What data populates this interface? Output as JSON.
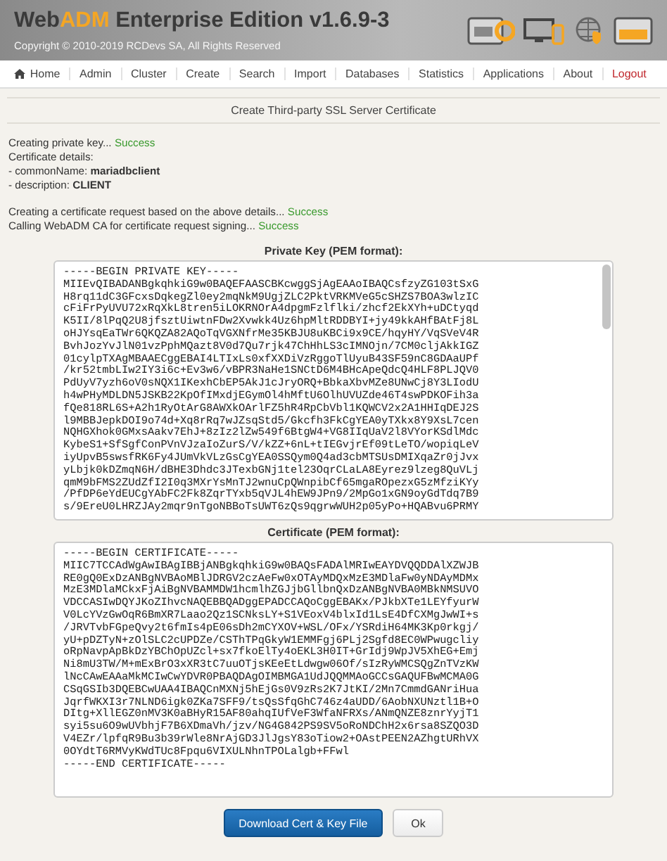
{
  "header": {
    "title_segments": [
      {
        "text": "Web",
        "kind": "plain"
      },
      {
        "text": "ADM",
        "kind": "accent"
      },
      {
        "text": " Enterprise Edition v1.6.9-3",
        "kind": "plain"
      }
    ],
    "copyright": "Copyright © 2010-2019 RCDevs SA, All Rights Reserved"
  },
  "nav": [
    {
      "label": "Home",
      "kind": "home"
    },
    {
      "label": "Admin",
      "kind": "link"
    },
    {
      "label": "Cluster",
      "kind": "link"
    },
    {
      "label": "Create",
      "kind": "link"
    },
    {
      "label": "Search",
      "kind": "link"
    },
    {
      "label": "Import",
      "kind": "link"
    },
    {
      "label": "Databases",
      "kind": "link"
    },
    {
      "label": "Statistics",
      "kind": "link"
    },
    {
      "label": "Applications",
      "kind": "link"
    },
    {
      "label": "About",
      "kind": "link"
    },
    {
      "label": "Logout",
      "kind": "logout"
    }
  ],
  "page_title": "Create Third-party SSL Server Certificate",
  "log_groups": [
    [
      {
        "kind": "step",
        "text": "Creating private key...",
        "result": "Success"
      },
      {
        "kind": "plain",
        "text": "Certificate details:"
      },
      {
        "kind": "detail",
        "text": "- commonName:",
        "value": "mariadbclient"
      },
      {
        "kind": "detail",
        "text": "- description:",
        "value": "CLIENT"
      }
    ],
    [
      {
        "kind": "step",
        "text": "Creating a certificate request based on the above details...",
        "result": "Success"
      },
      {
        "kind": "step",
        "text": "Calling WebADM CA for certificate request signing...",
        "result": "Success"
      }
    ]
  ],
  "private_key": {
    "label": "Private Key (PEM format):",
    "lines": [
      "-----BEGIN PRIVATE KEY-----",
      "MIIEvQIBADANBgkqhkiG9w0BAQEFAASCBKcwggSjAgEAAoIBAQCsfzyZG103tSxG",
      "H8rq11dC3GFcxsDqkegZl0ey2mqNkM9UgjZLC2PktVRKMVeG5cSHZS7BOA3wlzIC",
      "cFiFrPyUVU72xRqXkL8tren5iLOKRNOrA4dpgmFzlflki/zhcf2EkXYh+uDCtyqd",
      "K5II/8lPqQ2U8jfsztUiwtnFDw2Xvwkk4Uz6hpMltRDDBYI+jy49kkAHfBAtFj8L",
      "oHJYsqEaTWr6QKQZA82AQoTqVGXNfrMe35KBJU8uKBCi9x9CE/hqyHY/VqSVeV4R",
      "BvhJozYvJlN01vzPphMQazt8V0d7Qu7rjk47ChHhLS3cIMNOjn/7CM0cljAkkIGZ",
      "01cylpTXAgMBAAECggEBAI4LTIxLs0xfXXDiVzRggoTlUyuB43SF59nC8GDAaUPf",
      "/kr52tmbLIw2IY3i6c+Ev3w6/vBPR3NaHe1SNCtD6M4BHcApeQdcQ4HLF8PLJQV0",
      "PdUyV7yzh6oV0sNQX1IKexhCbEP5AkJ1cJryORQ+BbkaXbvMZe8UNwCj8Y3LIodU",
      "h4wPHyMDLDN5JSKB22KpOfIMxdjEGymOl4hMftU6OlhUVUZde46T4swPDKOFih3a",
      "fQe818RL6S+A2h1RyOtArG8AWXkOArlFZ5hR4RpCbVbl1KQWCV2x2A1HHIqDEJ2S",
      "l9MBBJepkDOI9o74d+Xq8rRq7wJZsqStd5/Gkcfh3FkCgYEA0yTXkx8Y9XsL7cen",
      "NQHGXhok0GMxsAakv7EhJ+8zIz2lZw549f6BtgW4+VG8IIqUaV2l8VYorKSdlMdc",
      "KybeS1+SfSgfConPVnVJzaIoZurS/V/kZZ+6nL+tIEGvjrEf09tLeTO/wopiqLeV",
      "iyUpvB5swsfRK6Fy4JUmVkVLzGsCgYEA0SSQym0Q4ad3cbMTSUsDMIXqaZr0jJvx",
      "yLbjk0kDZmqN6H/dBHE3Dhdc3JTexbGNj1tel23OqrCLaLA8Eyrez9lzeg8QuVLj",
      "qmM9bFMS2ZUdZfI2I0q3MXrYsMnTJ2wnuCpQWnpibCf65mgaROpezxG5zMfziKYy",
      "/PfDP6eYdEUCgYAbFC2Fk8ZqrTYxb5qVJL4hEW9JPn9/2MpGo1xGN9oyGdTdq7B9",
      "s/9EreU0LHRZJAy2mqr9nTgoNBBoTsUWT6zQs9qgrwWUH2p05yPo+HQABvu6PRMY"
    ]
  },
  "certificate": {
    "label": "Certificate (PEM format):",
    "lines": [
      "-----BEGIN CERTIFICATE-----",
      "MIIC7TCCAdWgAwIBAgIBBjANBgkqhkiG9w0BAQsFADAlMRIwEAYDVQQDDAlXZWJB",
      "RE0gQ0ExDzANBgNVBAoMBlJDRGV2czAeFw0xOTAyMDQxMzE3MDlaFw0yNDAyMDMx",
      "MzE3MDlaMCkxFjAiBgNVBAMMDW1hcmlhZGJjbGllbnQxDzANBgNVBA0MBkNMSUVO",
      "VDCCASIwDQYJKoZIhvcNAQEBBQADggEPADCCAQoCggEBAKx/PJkbXTe1LEYfyurW",
      "V0LcYVzGwOqR6BmXR7Laao2Qz1SCNksLY+S1VEoxV4blxId1LsE4DfCXMgJwWI+s",
      "/JRVTvbFGpeQvy2t6fmIs4pE06sDh2mCYXOV+WSL/OFx/YSRdiH64MK3Kp0rkgj/",
      "yU+pDZTyN+zOlSLC2cUPDZe/CSThTPqGkyW1EMMFgj6PLj2Sgfd8EC0WPwugcliy",
      "oRpNavpApBkDzYBChOpUZcl+sx7fkoElTy4oEKL3H0IT+GrIdj9WpJV5XhEG+Emj",
      "Ni8mU3TW/M+mExBrO3xXR3tC7uuOTjsKEeEtLdwgw06Of/sIzRyWMCSQgZnTVzKW",
      "lNcCAwEAAaMkMCIwCwYDVR0PBAQDAgOIMBMGA1UdJQQMMAoGCCsGAQUFBwMCMA0G",
      "CSqGSIb3DQEBCwUAA4IBAQCnMXNj5hEjGs0V9zRs2K7JtKI/2Mn7CmmdGANriHua",
      "JqrfWKXI3r7NLND6igk0ZKa7SFF9/tsQsSfqGhC746z4aUDD/6AobNXUNztl1B+O",
      "DItg+XllEGZ0nMV3K0aBHyR15AF80ahqIUfVeF3WfaNFRXs/ANmQNZE8znrYyjT1",
      "syi5su6O9wUVbhjF7B6XDmaVh/jzv/NG4G842PS9SV5oRoNDChH2x6rsa8SZQO3D",
      "V4EZr/lpfqR9Bu3b39rWle8NrAjGD3JlJgsY83oTiow2+OAstPEEN2AZhgtURhVX",
      "0OYdtT6RMVyKWdTUc8Fpqu6VIXULNhnTPOLalgb+FFwl",
      "-----END CERTIFICATE-----"
    ]
  },
  "buttons": [
    {
      "label": "Download Cert & Key File",
      "kind": "primary"
    },
    {
      "label": "Ok",
      "kind": "default"
    }
  ]
}
